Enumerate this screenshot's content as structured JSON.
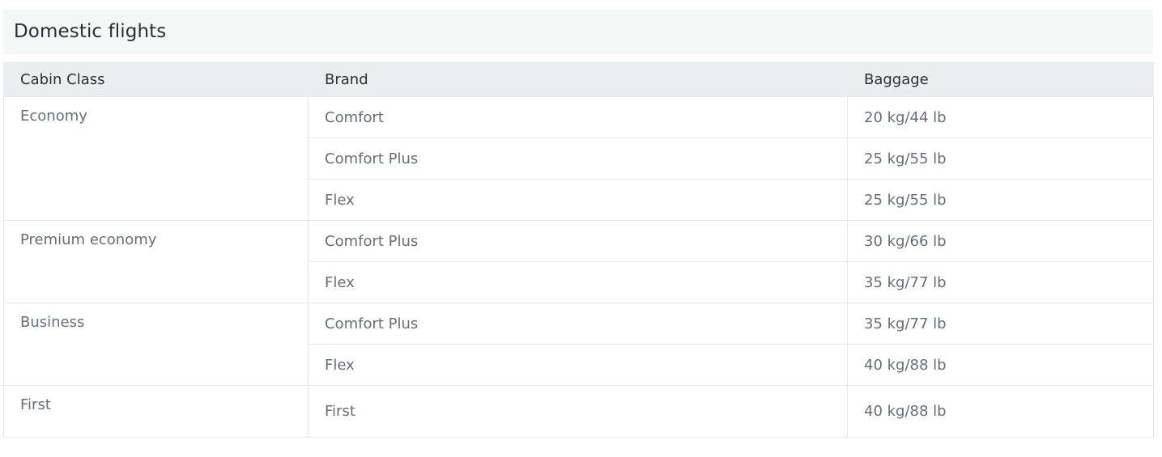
{
  "section": {
    "title": "Domestic flights"
  },
  "table": {
    "headers": [
      "Cabin Class",
      "Brand",
      "Baggage"
    ],
    "groups": [
      {
        "cabin": "Economy",
        "rows": [
          {
            "brand": "Comfort",
            "baggage": "20 kg/44 lb"
          },
          {
            "brand": "Comfort Plus",
            "baggage": "25 kg/55 lb"
          },
          {
            "brand": "Flex",
            "baggage": "25 kg/55 lb"
          }
        ]
      },
      {
        "cabin": "Premium economy",
        "rows": [
          {
            "brand": "Comfort Plus",
            "baggage": "30 kg/66 lb"
          },
          {
            "brand": "Flex",
            "baggage": "35 kg/77 lb"
          }
        ]
      },
      {
        "cabin": "Business",
        "rows": [
          {
            "brand": "Comfort Plus",
            "baggage": "35 kg/77 lb"
          },
          {
            "brand": "Flex",
            "baggage": "40 kg/88 lb"
          }
        ]
      },
      {
        "cabin": "First",
        "rows": [
          {
            "brand": "First",
            "baggage": "40 kg/88 lb"
          }
        ]
      }
    ]
  }
}
